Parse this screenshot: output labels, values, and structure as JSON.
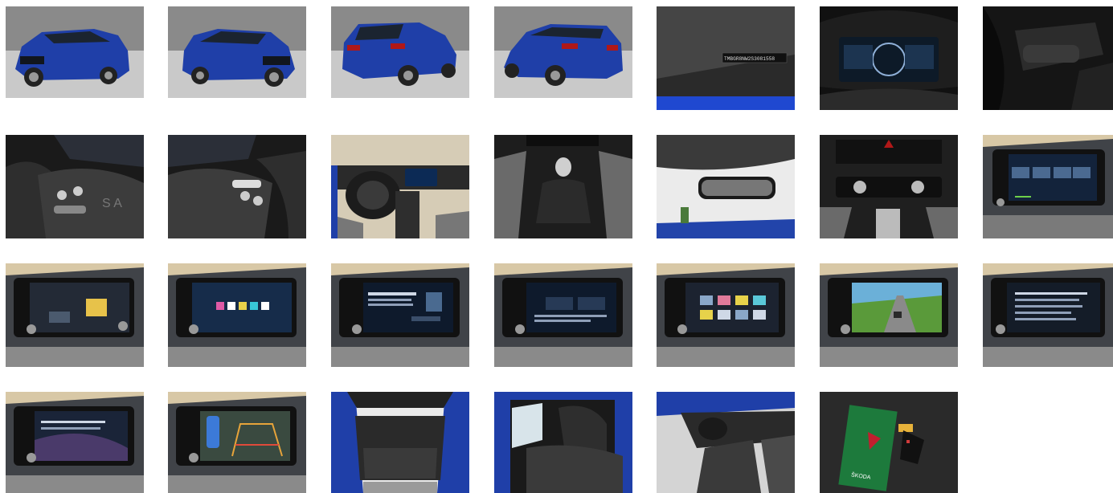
{
  "gallery": {
    "photos": [
      {
        "subject": "front-left exterior"
      },
      {
        "subject": "front-right exterior"
      },
      {
        "subject": "rear-left exterior"
      },
      {
        "subject": "rear-right exterior"
      },
      {
        "subject": "windshield VIN plate",
        "vin_text": "TMBGR8NW2S3081558"
      },
      {
        "subject": "digital instrument cluster"
      },
      {
        "subject": "steering column stalk"
      },
      {
        "subject": "steering wheel left controls"
      },
      {
        "subject": "steering wheel right controls"
      },
      {
        "subject": "dashboard overview"
      },
      {
        "subject": "gear shifter"
      },
      {
        "subject": "rear view mirror"
      },
      {
        "subject": "climate control"
      },
      {
        "subject": "infotainment home"
      },
      {
        "subject": "infotainment menu 1"
      },
      {
        "subject": "infotainment menu 2"
      },
      {
        "subject": "infotainment phone"
      },
      {
        "subject": "infotainment connect"
      },
      {
        "subject": "infotainment apps"
      },
      {
        "subject": "infotainment navigation"
      },
      {
        "subject": "infotainment settings"
      },
      {
        "subject": "infotainment service"
      },
      {
        "subject": "parking camera"
      },
      {
        "subject": "trunk"
      },
      {
        "subject": "rear seats"
      },
      {
        "subject": "front seats"
      },
      {
        "subject": "manuals and keys",
        "brand_text": "ŠKODA"
      }
    ]
  },
  "colors": {
    "car_blue": "#1f3fa8",
    "background": "#ffffff"
  }
}
